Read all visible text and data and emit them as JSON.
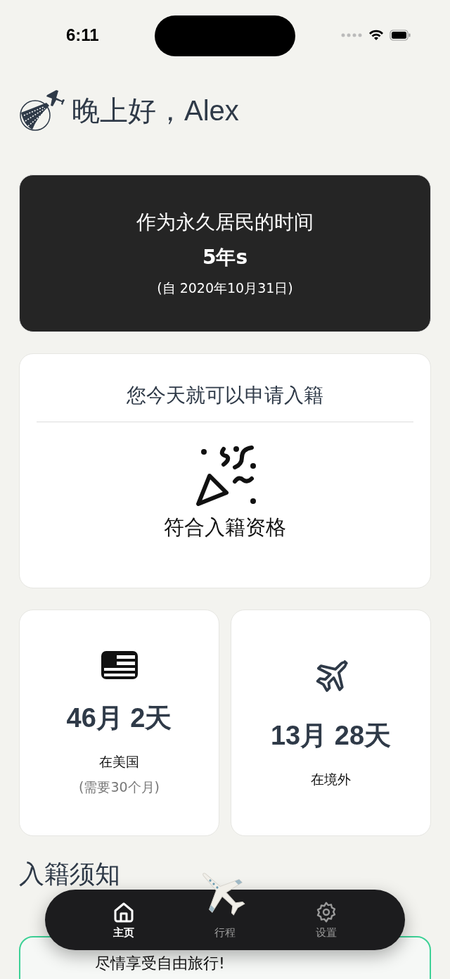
{
  "status_bar": {
    "time": "6:11"
  },
  "header": {
    "greeting": "晚上好，",
    "name": "Alex"
  },
  "residency_card": {
    "title": "作为永久居民的时间",
    "duration": "5年s",
    "since": "(自 2020年10月31日)"
  },
  "eligibility_card": {
    "title": "您今天就可以申请入籍",
    "status": "符合入籍资格"
  },
  "stats": [
    {
      "kind": "flag",
      "value": "46月 2天",
      "label": "在美国",
      "note": "(需要30个月)"
    },
    {
      "kind": "plane",
      "value": "13月 28天",
      "label": "在境外"
    }
  ],
  "section": {
    "title": "入籍须知"
  },
  "notice_card": {
    "text": "尽情享受自由旅行!"
  },
  "tabs": [
    {
      "kind": "home",
      "label": "主页",
      "selected": true
    },
    {
      "kind": "trips",
      "label": "行程",
      "selected": false
    },
    {
      "kind": "settings",
      "label": "设置",
      "selected": false
    }
  ]
}
